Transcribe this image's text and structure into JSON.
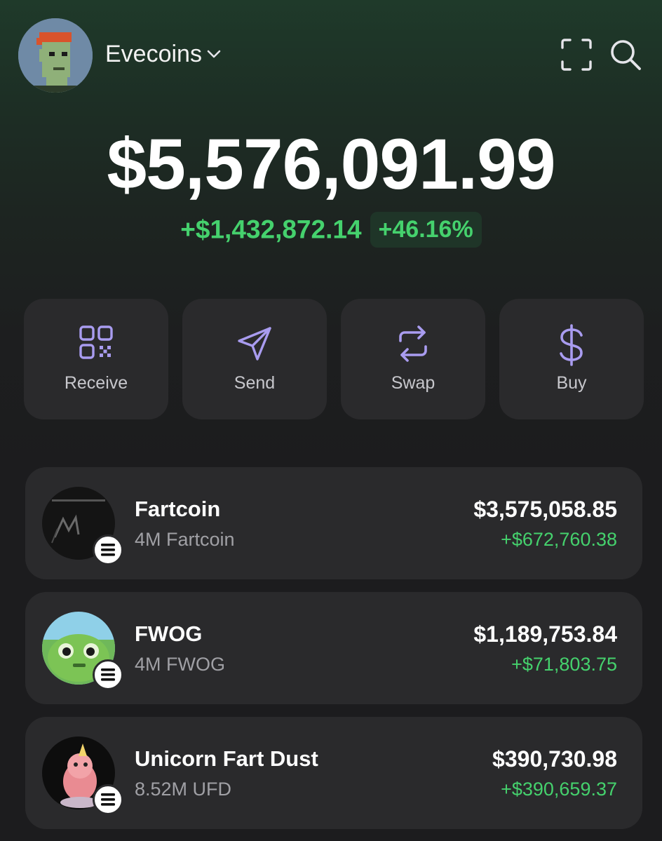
{
  "header": {
    "account_name": "Evecoins",
    "avatar_icon": "pixel-punk-avatar",
    "scan_icon": "scan-icon",
    "search_icon": "search-icon"
  },
  "balance": {
    "total": "$5,576,091.99",
    "change_amount": "+$1,432,872.14",
    "change_percent": "+46.16%"
  },
  "actions": [
    {
      "label": "Receive",
      "icon": "qr-code-icon"
    },
    {
      "label": "Send",
      "icon": "send-icon"
    },
    {
      "label": "Swap",
      "icon": "swap-icon"
    },
    {
      "label": "Buy",
      "icon": "dollar-icon"
    }
  ],
  "tokens": [
    {
      "name": "Fartcoin",
      "quantity": "4M Fartcoin",
      "value": "$3,575,058.85",
      "change": "+$672,760.38"
    },
    {
      "name": "FWOG",
      "quantity": "4M FWOG",
      "value": "$1,189,753.84",
      "change": "+$71,803.75"
    },
    {
      "name": "Unicorn Fart Dust",
      "quantity": "8.52M UFD",
      "value": "$390,730.98",
      "change": "+$390,659.37"
    }
  ],
  "colors": {
    "positive": "#45d16d",
    "accent_icon": "#a99cf0",
    "card_bg": "#2a2a2c"
  }
}
